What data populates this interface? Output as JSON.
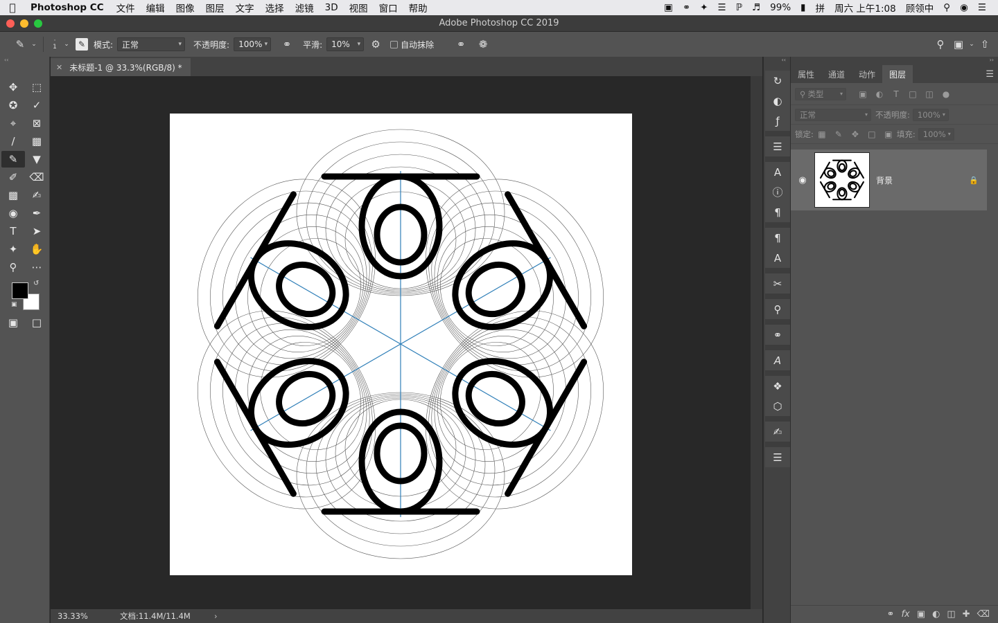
{
  "menubar": {
    "app_name": "Photoshop CC",
    "menus": [
      "文件",
      "编辑",
      "图像",
      "图层",
      "文字",
      "选择",
      "滤镜",
      "3D",
      "视图",
      "窗口",
      "帮助"
    ],
    "battery": "99%",
    "clock": "周六 上午1:08",
    "user": "顾领中",
    "input_method": "拼"
  },
  "window": {
    "title": "Adobe Photoshop CC 2019"
  },
  "options": {
    "brush_size": "1",
    "mode_label": "模式:",
    "mode_value": "正常",
    "opacity_label": "不透明度:",
    "opacity_value": "100%",
    "smooth_label": "平滑:",
    "smooth_value": "10%",
    "auto_erase_label": "自动抹除"
  },
  "document": {
    "tab_title": "未标题-1 @ 33.3%(RGB/8) *"
  },
  "status": {
    "zoom": "33.33%",
    "doc_info": "文档:11.4M/11.4M"
  },
  "layers_panel": {
    "tabs": [
      "属性",
      "通道",
      "动作",
      "图层"
    ],
    "active_tab": "图层",
    "filter_placeholder": "类型",
    "blend_mode": "正常",
    "opacity_label": "不透明度:",
    "opacity_value": "100%",
    "lock_label": "锁定:",
    "fill_label": "填充:",
    "fill_value": "100%",
    "layers": [
      {
        "name": "背景",
        "visible": true,
        "locked": true
      }
    ]
  },
  "colors": {
    "foreground": "#000000",
    "background": "#ffffff",
    "symmetry_guide": "#2f7fb8"
  }
}
